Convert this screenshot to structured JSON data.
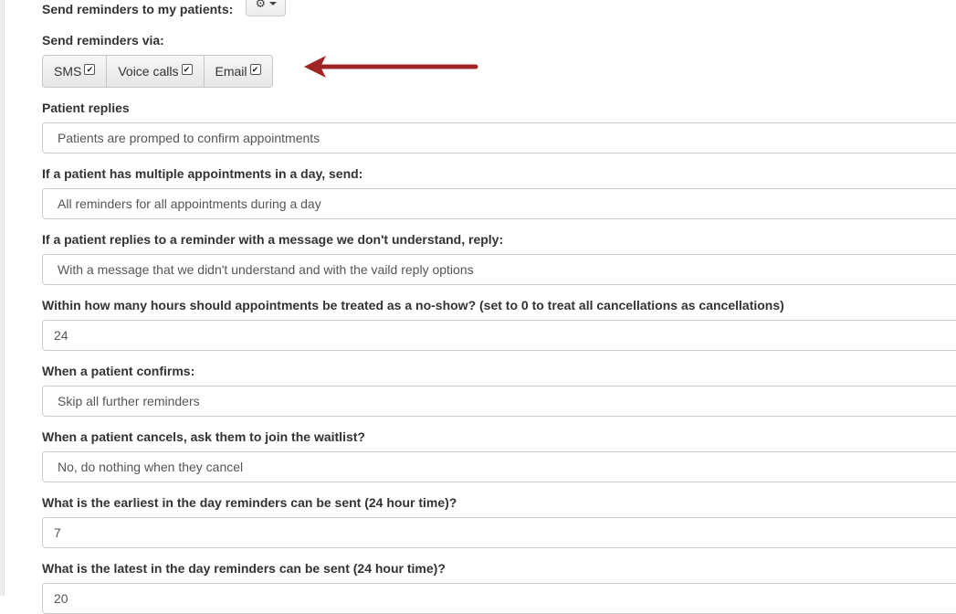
{
  "reminders_for_patients": {
    "label": "Send reminders to my patients:",
    "menu_icon": "gear-icon"
  },
  "reminders_via": {
    "label": "Send reminders via:",
    "options": [
      {
        "label": "SMS",
        "checked": true
      },
      {
        "label": "Voice calls",
        "checked": true
      },
      {
        "label": "Email",
        "checked": true
      }
    ],
    "check_glyph": "✔"
  },
  "patient_replies": {
    "label": "Patient replies",
    "value": "Patients are promped to confirm appointments"
  },
  "multiple_appointments": {
    "label": "If a patient has multiple appointments in a day, send:",
    "value": "All reminders for all appointments during a day"
  },
  "unknown_reply": {
    "label": "If a patient replies to a reminder with a message we don't understand, reply:",
    "value": "With a message that we didn't understand and with the vaild reply options"
  },
  "no_show_hours": {
    "label": "Within how many hours should appointments be treated as a no-show? (set to 0 to treat all cancellations as cancellations)",
    "value": "24"
  },
  "on_confirm": {
    "label": "When a patient confirms:",
    "value": "Skip all further reminders"
  },
  "on_cancel": {
    "label": "When a patient cancels, ask them to join the waitlist?",
    "value": "No, do nothing when they cancel"
  },
  "earliest_time": {
    "label": "What is the earliest in the day reminders can be sent (24 hour time)?",
    "value": "7"
  },
  "latest_time": {
    "label": "What is the latest in the day reminders can be sent (24 hour time)?",
    "value": "20"
  },
  "colors": {
    "annotation_arrow": "#a02424"
  }
}
